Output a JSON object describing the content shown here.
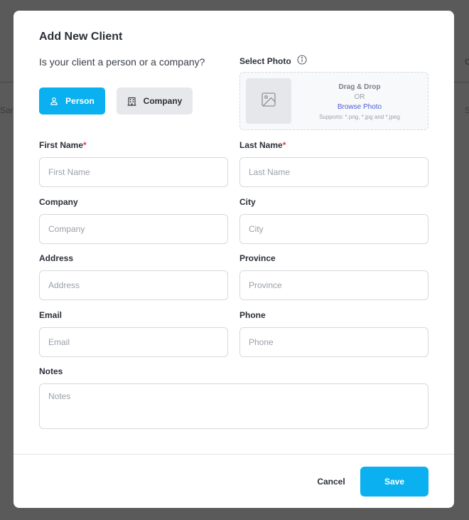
{
  "background": {
    "left_fragment": "San",
    "right_fragment_top": "C",
    "right_fragment": "S"
  },
  "modal": {
    "title": "Add New Client",
    "question": "Is your client a person or a company?",
    "type_options": [
      {
        "label": "Person",
        "icon": "person-icon",
        "selected": true
      },
      {
        "label": "Company",
        "icon": "building-icon",
        "selected": false
      }
    ],
    "photo": {
      "label": "Select Photo",
      "info_icon": "info-icon",
      "drag_text": "Drag & Drop",
      "or_text": "OR",
      "browse_text": "Browse Photo",
      "support_text": "Supports: *.png, *.jpg and *.jpeg"
    },
    "fields": {
      "first_name": {
        "label": "First Name",
        "required_mark": "*",
        "placeholder": "First Name",
        "value": ""
      },
      "last_name": {
        "label": "Last Name",
        "required_mark": "*",
        "placeholder": "Last Name",
        "value": ""
      },
      "company": {
        "label": "Company",
        "placeholder": "Company",
        "value": ""
      },
      "city": {
        "label": "City",
        "placeholder": "City",
        "value": ""
      },
      "address": {
        "label": "Address",
        "placeholder": "Address",
        "value": ""
      },
      "province": {
        "label": "Province",
        "placeholder": "Province",
        "value": ""
      },
      "email": {
        "label": "Email",
        "placeholder": "Email",
        "value": ""
      },
      "phone": {
        "label": "Phone",
        "placeholder": "Phone",
        "value": ""
      },
      "notes": {
        "label": "Notes",
        "placeholder": "Notes",
        "value": ""
      }
    },
    "footer": {
      "cancel_label": "Cancel",
      "save_label": "Save"
    }
  },
  "colors": {
    "accent": "#0ab0ef",
    "link": "#4f5ed4",
    "required": "#e8344e",
    "overlay": "#5b5a5a"
  }
}
